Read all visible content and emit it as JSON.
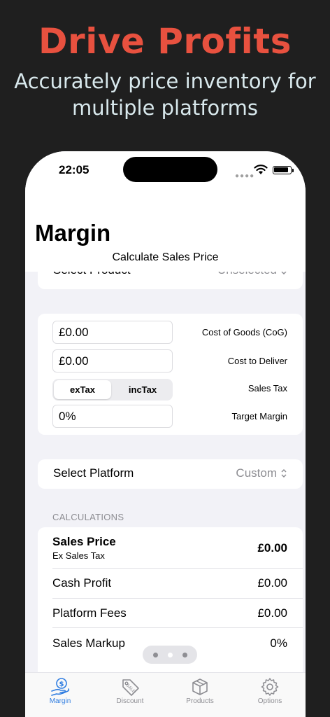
{
  "promo": {
    "title": "Drive Profits",
    "subtitle_line1": "Accurately price inventory for",
    "subtitle_line2": "multiple platforms"
  },
  "status_bar": {
    "time": "22:05"
  },
  "header": {
    "title": "Margin",
    "subtitle": "Calculate Sales Price"
  },
  "product": {
    "label": "Select Product",
    "value": "Unselected"
  },
  "inputs": {
    "cost_of_goods": {
      "value": "£0.00",
      "label": "Cost of Goods (CoG)"
    },
    "cost_to_deliver": {
      "value": "£0.00",
      "label": "Cost to Deliver"
    },
    "sales_tax": {
      "label": "Sales Tax",
      "options": [
        "exTax",
        "incTax"
      ],
      "selected": "exTax"
    },
    "target_margin": {
      "value": "0%",
      "label": "Target Margin"
    }
  },
  "platform": {
    "label": "Select Platform",
    "value": "Custom"
  },
  "calculations": {
    "header": "CALCULATIONS",
    "sales_price": {
      "label": "Sales Price",
      "sublabel": "Ex Sales Tax",
      "value": "£0.00"
    },
    "cash_profit": {
      "label": "Cash Profit",
      "value": "£0.00"
    },
    "platform_fees": {
      "label": "Platform Fees",
      "value": "£0.00"
    },
    "sales_markup": {
      "label": "Sales Markup",
      "value": "0%"
    }
  },
  "tabs": [
    {
      "label": "Margin",
      "icon": "margin-coin-hand-icon",
      "active": true
    },
    {
      "label": "Discount",
      "icon": "sale-tag-icon",
      "active": false
    },
    {
      "label": "Products",
      "icon": "product-boxes-icon",
      "active": false
    },
    {
      "label": "Options",
      "icon": "gear-icon",
      "active": false
    }
  ],
  "colors": {
    "promo_accent": "#e8513f",
    "tab_active": "#2f7de1",
    "secondary_text": "#8e8e93"
  }
}
